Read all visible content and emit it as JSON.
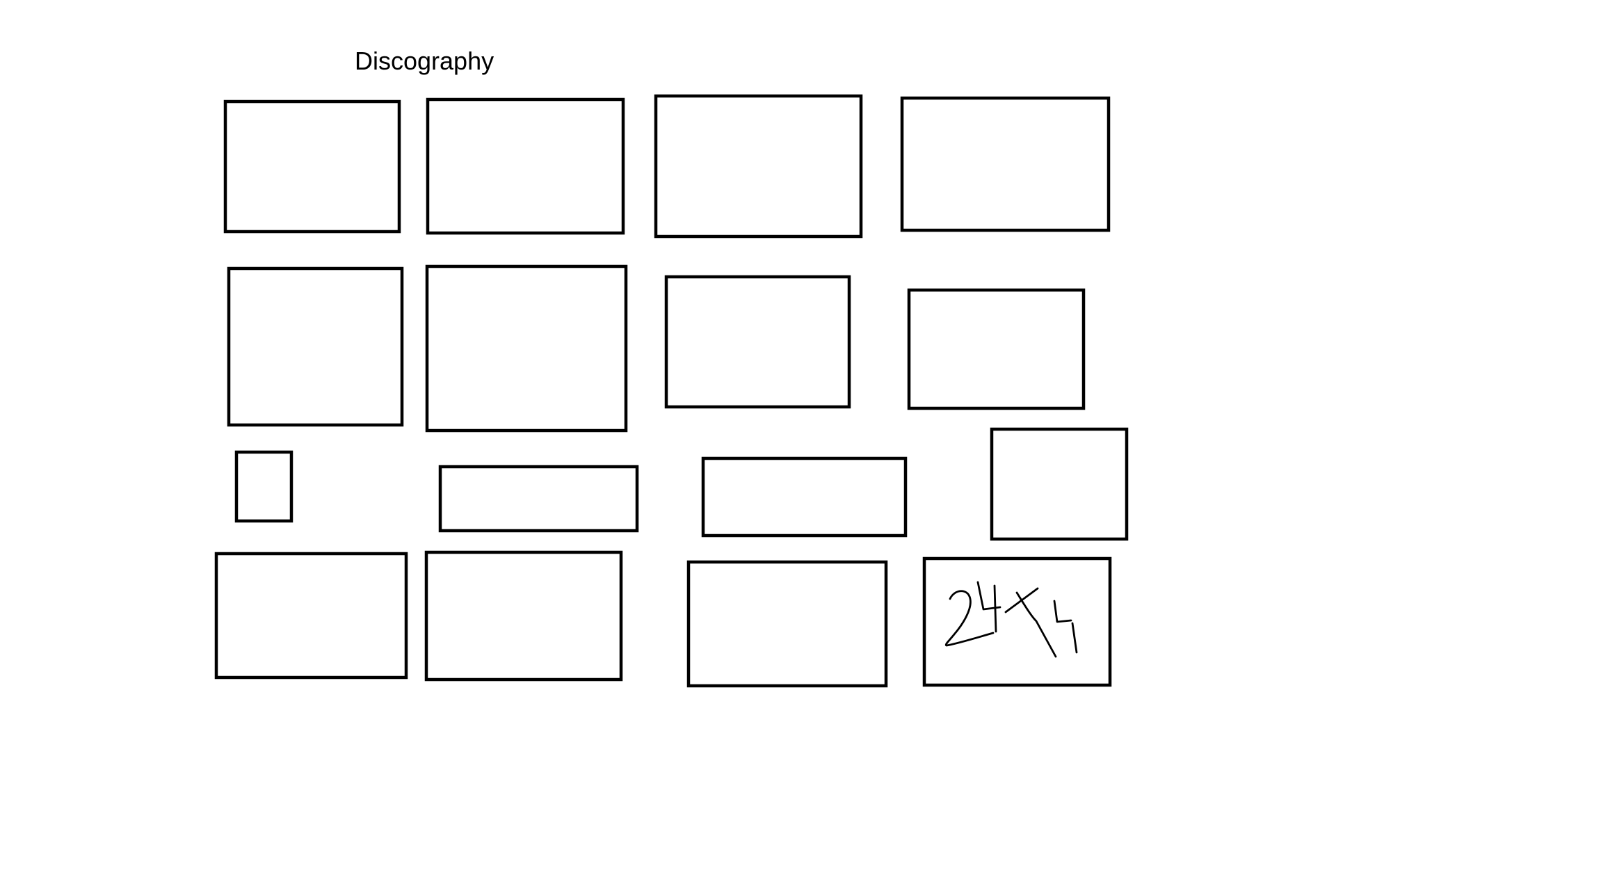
{
  "page": {
    "title": "Discography"
  },
  "grid": {
    "rows": 4,
    "columns": 4,
    "placeholder_count": 16
  },
  "handwritten_note": {
    "text": "24x4"
  },
  "colors": {
    "background": "#ffffff",
    "stroke": "#000000"
  }
}
